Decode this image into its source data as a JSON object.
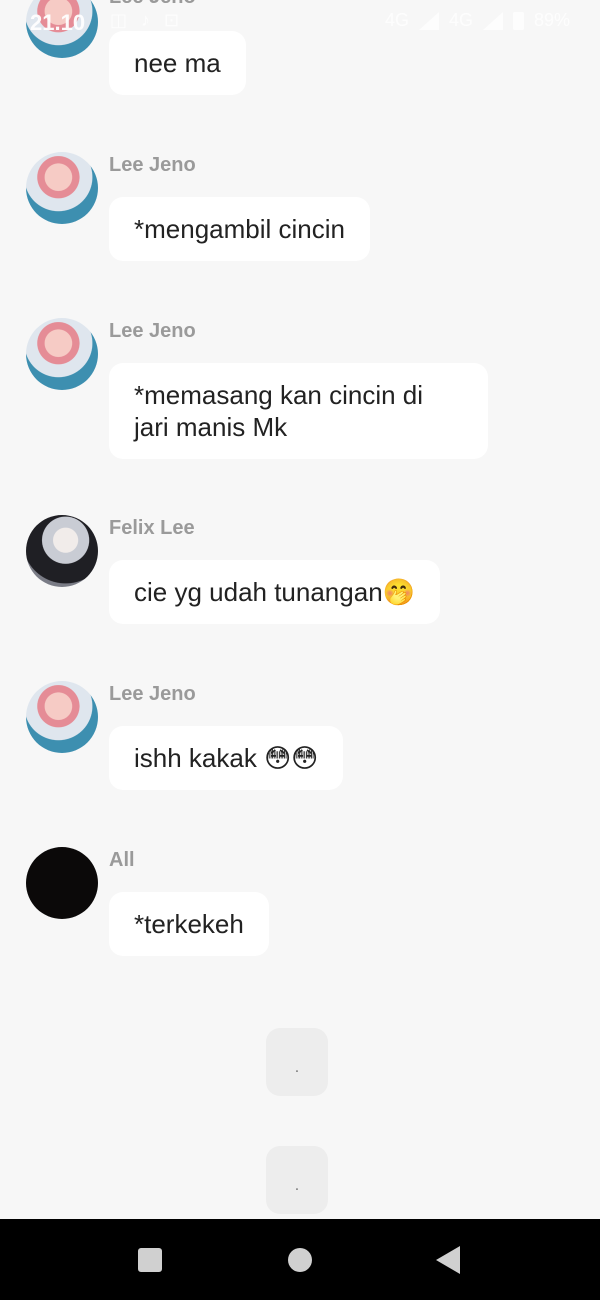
{
  "status_bar": {
    "time": "21.10",
    "left_icons": [
      "notification-icon",
      "tiktok-icon",
      "lock-icon"
    ],
    "network_1": "4G",
    "network_2": "4G",
    "battery": "89%"
  },
  "messages": [
    {
      "sender": "Lee Jeno",
      "text": "nee ma"
    },
    {
      "sender": "Lee Jeno",
      "text": "*mengambil cincin"
    },
    {
      "sender": "Lee Jeno",
      "text": "*memasang kan cincin di jari manis Mk"
    },
    {
      "sender": "Felix Lee",
      "text": "cie yg udah tunangan🤭"
    },
    {
      "sender": "Lee Jeno",
      "text": "ishh kakak 😳😳"
    },
    {
      "sender": "All",
      "text": "*terkekeh"
    }
  ],
  "placeholders": [
    {
      "text": "."
    },
    {
      "text": "."
    }
  ],
  "nav": {
    "icons": [
      "recent-apps-icon",
      "home-icon",
      "back-icon"
    ]
  }
}
